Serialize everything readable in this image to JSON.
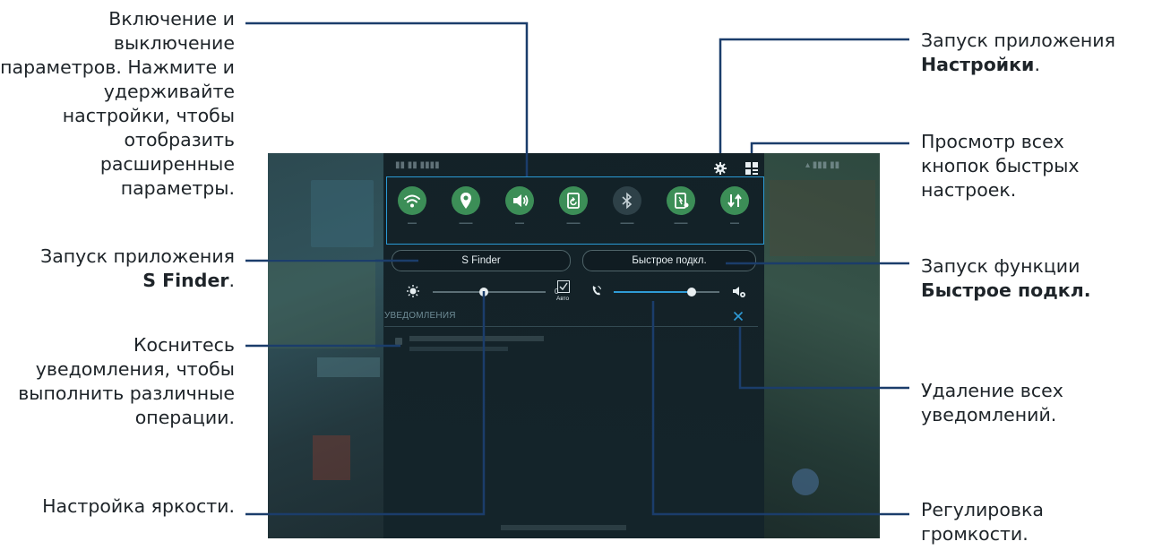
{
  "callouts": {
    "toggle_settings": "Включение и выключение параметров. Нажмите и удерживайте настройки, чтобы отобразить расширенные параметры.",
    "s_finder_prefix": "Запуск приложения",
    "s_finder_bold": "S Finder",
    "notification": "Коснитесь уведомления, чтобы выполнить различные операции.",
    "brightness": "Настройка яркости.",
    "settings_prefix": "Запуск приложения",
    "settings_bold": "Настройки",
    "all_quick": "Просмотр всех кнопок быстрых настроек.",
    "quick_connect_prefix": "Запуск функции",
    "quick_connect_bold": "Быстрое подкл.",
    "clear_all": "Удаление всех уведомлений.",
    "volume": "Регулировка громкости."
  },
  "screen": {
    "quick_settings": [
      {
        "icon": "wifi-icon"
      },
      {
        "icon": "location-icon"
      },
      {
        "icon": "sound-icon"
      },
      {
        "icon": "screen-rotation-icon"
      },
      {
        "icon": "bluetooth-icon"
      },
      {
        "icon": "power-saving-icon"
      },
      {
        "icon": "sync-icon"
      }
    ],
    "s_finder_label": "S Finder",
    "quick_connect_label": "Быстрое подкл.",
    "brightness_value": "0",
    "brightness_level": 0.45,
    "auto_label": "Авто",
    "volume_level": 0.74,
    "notifications_header": "УВЕДОМЛЕНИЯ",
    "settings_icon": "gear-icon",
    "all_quick_icon": "grid-icon",
    "clear_icon": "close-icon"
  },
  "colors": {
    "accent": "#2a9ad5",
    "toggle_on": "#3c8e57",
    "callout_text": "#1e2429"
  }
}
